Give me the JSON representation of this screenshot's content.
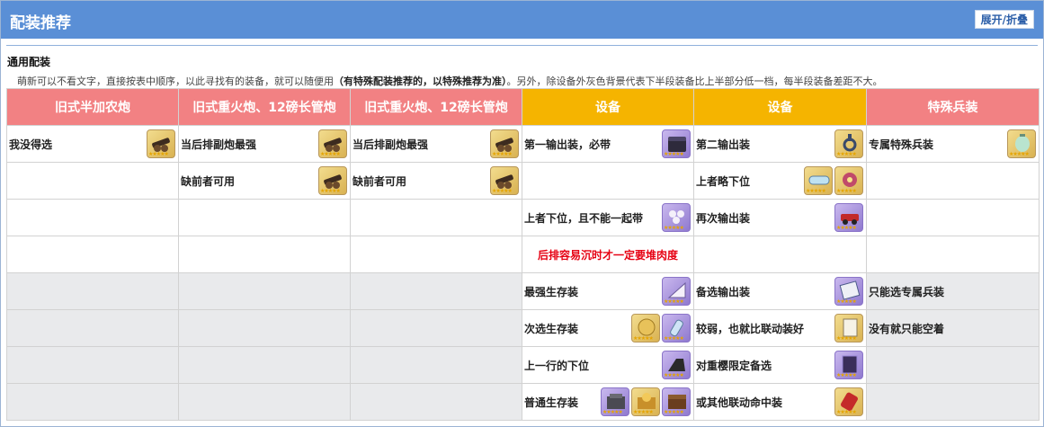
{
  "header": {
    "title": "配装推荐",
    "toggle_label": "展开/折叠"
  },
  "section": {
    "title": "通用配装",
    "note_before": "萌新可以不看文字，直接按表中顺序，以此寻找有的装备，就可以随便用",
    "note_bold": "（有特殊配装推荐的，以特殊推荐为准）",
    "note_after": "。另外，除设备外灰色背景代表下半段装备比上半部分低一档，每半段装备差距不大。"
  },
  "columns": [
    {
      "label": "旧式半加农炮",
      "color": "#f28183"
    },
    {
      "label": "旧式重火炮、12磅长管炮",
      "color": "#f28183"
    },
    {
      "label": "旧式重火炮、12磅长管炮",
      "color": "#f28183"
    },
    {
      "label": "设备",
      "color": "#f5b400"
    },
    {
      "label": "设备",
      "color": "#f5b400"
    },
    {
      "label": "特殊兵装",
      "color": "#f28183"
    }
  ],
  "rows": [
    {
      "c1": {
        "text": "我没得选",
        "icons": [
          "cannon-icon"
        ]
      },
      "c2": {
        "text": "当后排副炮最强",
        "icons": [
          "cannon-icon"
        ]
      },
      "c3": {
        "text": "当后排副炮最强",
        "icons": [
          "cannon-icon"
        ]
      },
      "c4": {
        "text": "第一输出装，必带",
        "icons": [
          "chest-icon"
        ]
      },
      "c5": {
        "text": "第二输出装",
        "icons": [
          "hook-icon"
        ]
      },
      "c6": {
        "text": "专属特殊兵装",
        "icons": [
          "lantern-icon"
        ]
      }
    },
    {
      "c1": {
        "text": "",
        "icons": []
      },
      "c2": {
        "text": "缺前者可用",
        "icons": [
          "cannon-icon"
        ]
      },
      "c3": {
        "text": "缺前者可用",
        "icons": [
          "cannon-icon"
        ]
      },
      "c4": {
        "text": "",
        "icons": []
      },
      "c5": {
        "text": "上者略下位",
        "icons": [
          "capsule-icon",
          "flower-icon"
        ]
      },
      "c6": {
        "text": "",
        "icons": []
      }
    },
    {
      "c1": {
        "text": "",
        "icons": []
      },
      "c2": {
        "text": "",
        "icons": []
      },
      "c3": {
        "text": "",
        "icons": []
      },
      "c4": {
        "text": "上者下位，且不能一起带",
        "icons": [
          "pearls-icon"
        ]
      },
      "c5": {
        "text": "再次输出装",
        "icons": [
          "car-icon"
        ]
      },
      "c6": {
        "text": "",
        "icons": []
      }
    },
    {
      "c1": {
        "text": "",
        "icons": []
      },
      "c2": {
        "text": "",
        "icons": []
      },
      "c3": {
        "text": "",
        "icons": []
      },
      "c4": {
        "text": "后排容易沉时才一定要堆肉度",
        "icons": [],
        "red": true
      },
      "c5": {
        "text": "",
        "icons": []
      },
      "c6": {
        "text": "",
        "icons": []
      }
    },
    {
      "c1": {
        "text": "",
        "icons": []
      },
      "c2": {
        "text": "",
        "icons": []
      },
      "c3": {
        "text": "",
        "icons": []
      },
      "c4": {
        "text": "最强生存装",
        "icons": [
          "fan-icon"
        ]
      },
      "c5": {
        "text": "备选输出装",
        "icons": [
          "manual-icon"
        ]
      },
      "c6": {
        "text": "只能选专属兵装",
        "icons": []
      }
    },
    {
      "c1": {
        "text": "",
        "icons": []
      },
      "c2": {
        "text": "",
        "icons": []
      },
      "c3": {
        "text": "",
        "icons": []
      },
      "c4": {
        "text": "次选生存装",
        "icons": [
          "medal-icon",
          "bottle-icon"
        ]
      },
      "c5": {
        "text": "较弱，也就比联动装好",
        "icons": [
          "paper-icon"
        ]
      },
      "c6": {
        "text": "没有就只能空着",
        "icons": []
      }
    },
    {
      "c1": {
        "text": "",
        "icons": []
      },
      "c2": {
        "text": "",
        "icons": []
      },
      "c3": {
        "text": "",
        "icons": []
      },
      "c4": {
        "text": "上一行的下位",
        "icons": [
          "heel-icon"
        ]
      },
      "c5": {
        "text": "对重樱限定备选",
        "icons": [
          "book-icon"
        ]
      },
      "c6": {
        "text": "",
        "icons": []
      }
    },
    {
      "c1": {
        "text": "",
        "icons": []
      },
      "c2": {
        "text": "",
        "icons": []
      },
      "c3": {
        "text": "",
        "icons": []
      },
      "c4": {
        "text": "普通生存装",
        "icons": [
          "crate-icon",
          "gold-chest-icon",
          "wood-chest-icon"
        ]
      },
      "c5": {
        "text": "或其他联动命中装",
        "icons": [
          "red-device-icon"
        ]
      },
      "c6": {
        "text": "",
        "icons": []
      }
    }
  ],
  "colors": {
    "header_bg": "#5a8fd6",
    "col_red": "#f28183",
    "col_gold": "#f5b400",
    "grey_bg": "#e9eaec",
    "warning_red": "#e60012"
  }
}
